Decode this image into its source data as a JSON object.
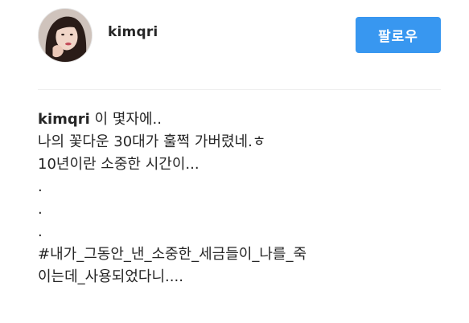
{
  "post": {
    "username": "kimqri",
    "follow_label": "팔로우"
  },
  "caption": {
    "author": "kimqri",
    "first_line_text": " 이 몇자에..",
    "lines": [
      "나의 꽃다운 30대가 훌쩍 가버렸네.ㅎ",
      "10년이란 소중한 시간이...",
      ".",
      ".",
      ".",
      "#내가_그동안_낸_소중한_세금들이_나를_죽",
      "이는데_사용되었다니...."
    ]
  },
  "colors": {
    "follow_button": "#3897f0",
    "text": "#262626",
    "divider": "#efefef"
  },
  "icons": {
    "avatar": "profile-photo"
  }
}
